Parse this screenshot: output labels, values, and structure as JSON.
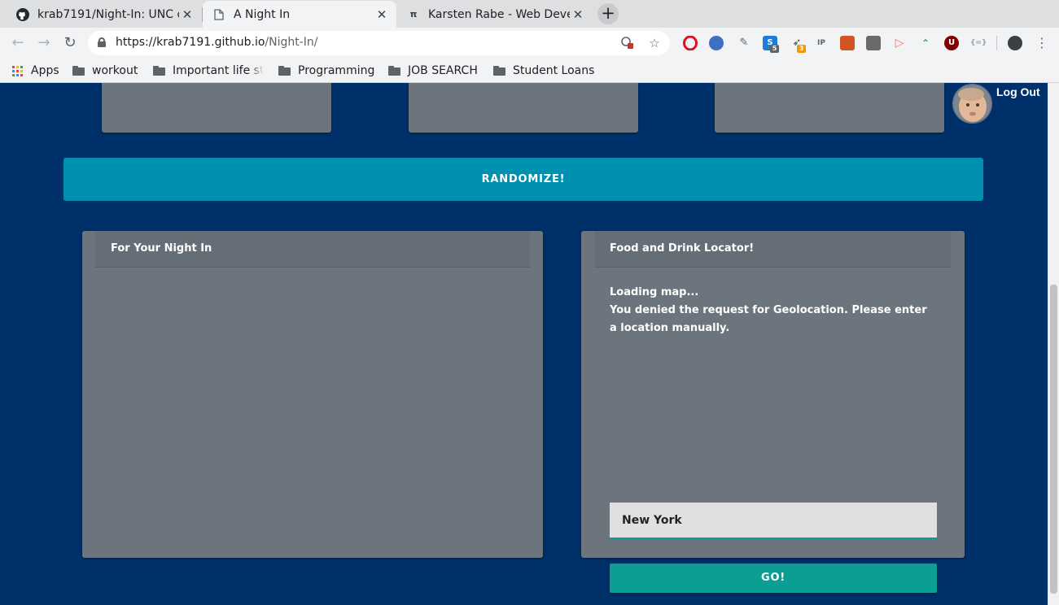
{
  "browser": {
    "tabs": [
      {
        "title": "krab7191/Night-In: UNC c",
        "icon": "github-icon",
        "active": false
      },
      {
        "title": "A Night In",
        "icon": "page-icon",
        "active": true
      },
      {
        "title": "Karsten Rabe - Web Devel",
        "icon": "pi-icon",
        "active": false
      }
    ],
    "tab_close": "✕",
    "new_tab": "+",
    "url_host": "https://krab7191.github.io",
    "url_path": "/Night-In/",
    "extension_badges": {
      "ext_s": "5",
      "ext_arrow": "3"
    },
    "bookmarks": [
      {
        "label": "Apps",
        "icon": "apps-grid-icon"
      },
      {
        "label": "workout",
        "icon": "folder-icon"
      },
      {
        "label": "Important life st",
        "icon": "folder-icon"
      },
      {
        "label": "Programming",
        "icon": "folder-icon"
      },
      {
        "label": "JOB SEARCH",
        "icon": "folder-icon"
      },
      {
        "label": "Student Loans",
        "icon": "folder-icon"
      }
    ]
  },
  "header": {
    "logout_label": "Log Out"
  },
  "randomize_label": "RANDOMIZE!",
  "panels": {
    "night_in": {
      "title": "For Your Night In"
    },
    "locator": {
      "title": "Food and Drink Locator!",
      "status_loading": "Loading map...",
      "status_denied": "You denied the request for Geolocation. Please enter a location manually.",
      "location_value": "New York",
      "go_label": "GO!"
    }
  },
  "colors": {
    "page_bg": "#00306a",
    "card_bg": "#6c757d",
    "randomize_bg": "#0090b0",
    "go_bg": "#0d9e93"
  }
}
